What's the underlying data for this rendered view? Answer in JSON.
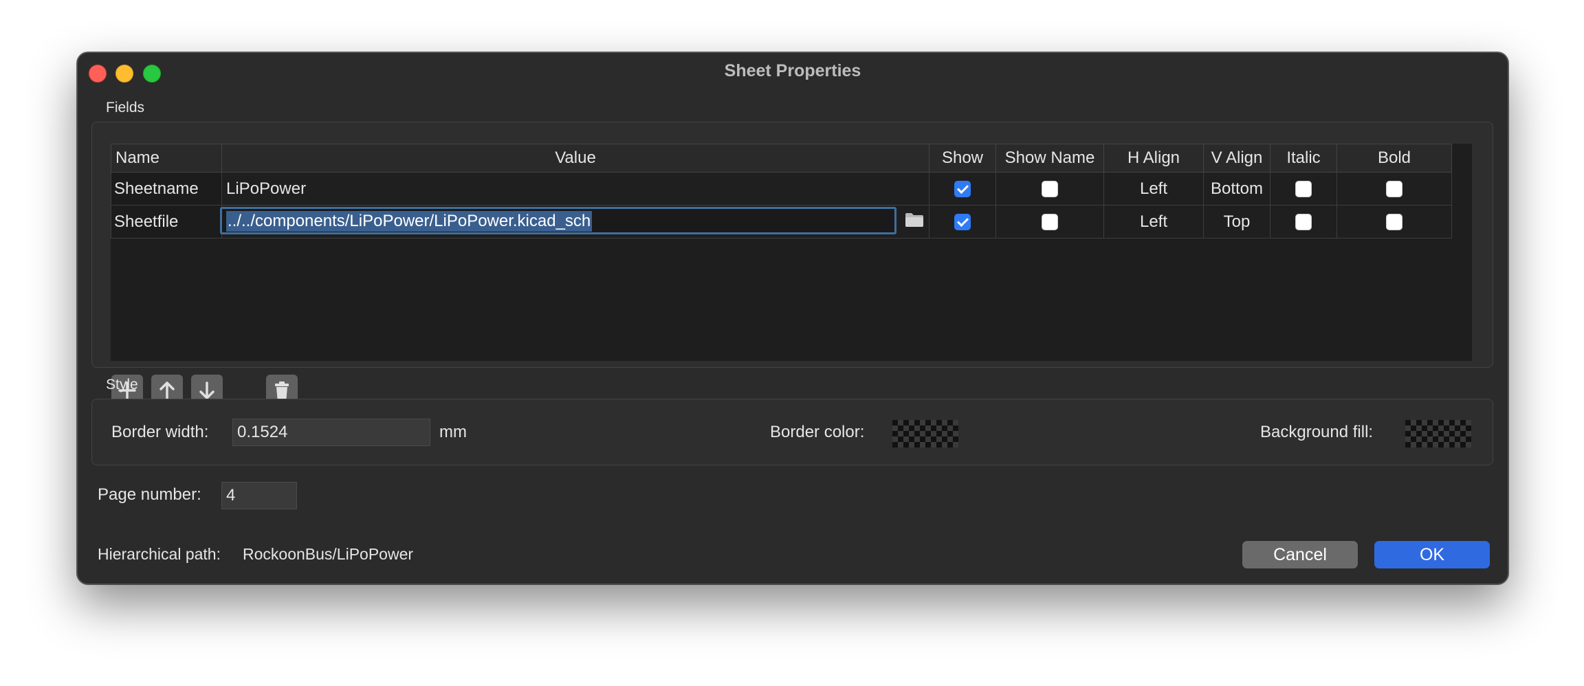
{
  "window": {
    "title": "Sheet Properties"
  },
  "fields_section": {
    "label": "Fields",
    "columns": [
      "Name",
      "Value",
      "Show",
      "Show Name",
      "H Align",
      "V Align",
      "Italic",
      "Bold"
    ],
    "rows": [
      {
        "name": "Sheetname",
        "value": "LiPoPower",
        "show": true,
        "show_name": false,
        "h_align": "Left",
        "v_align": "Bottom",
        "italic": false,
        "bold": false
      },
      {
        "name": "Sheetfile",
        "value": "../../components/LiPoPower/LiPoPower.kicad_sch",
        "show": true,
        "show_name": false,
        "h_align": "Left",
        "v_align": "Top",
        "italic": false,
        "bold": false
      }
    ],
    "toolbar_icons": [
      "add-icon",
      "arrow-up-icon",
      "arrow-down-icon",
      "trash-icon"
    ]
  },
  "style_section": {
    "label": "Style",
    "border_width_label": "Border width:",
    "border_width_value": "0.1524",
    "border_width_unit": "mm",
    "border_color_label": "Border color:",
    "background_fill_label": "Background fill:"
  },
  "page_number": {
    "label": "Page number:",
    "value": "4"
  },
  "hierarchical_path": {
    "label": "Hierarchical path:",
    "value": "RockoonBus/LiPoPower"
  },
  "buttons": {
    "cancel": "Cancel",
    "ok": "OK"
  },
  "colors": {
    "accent": "#2f6ae1",
    "checkbox": "#2f7bf5",
    "window_bg": "#2b2b2b"
  }
}
